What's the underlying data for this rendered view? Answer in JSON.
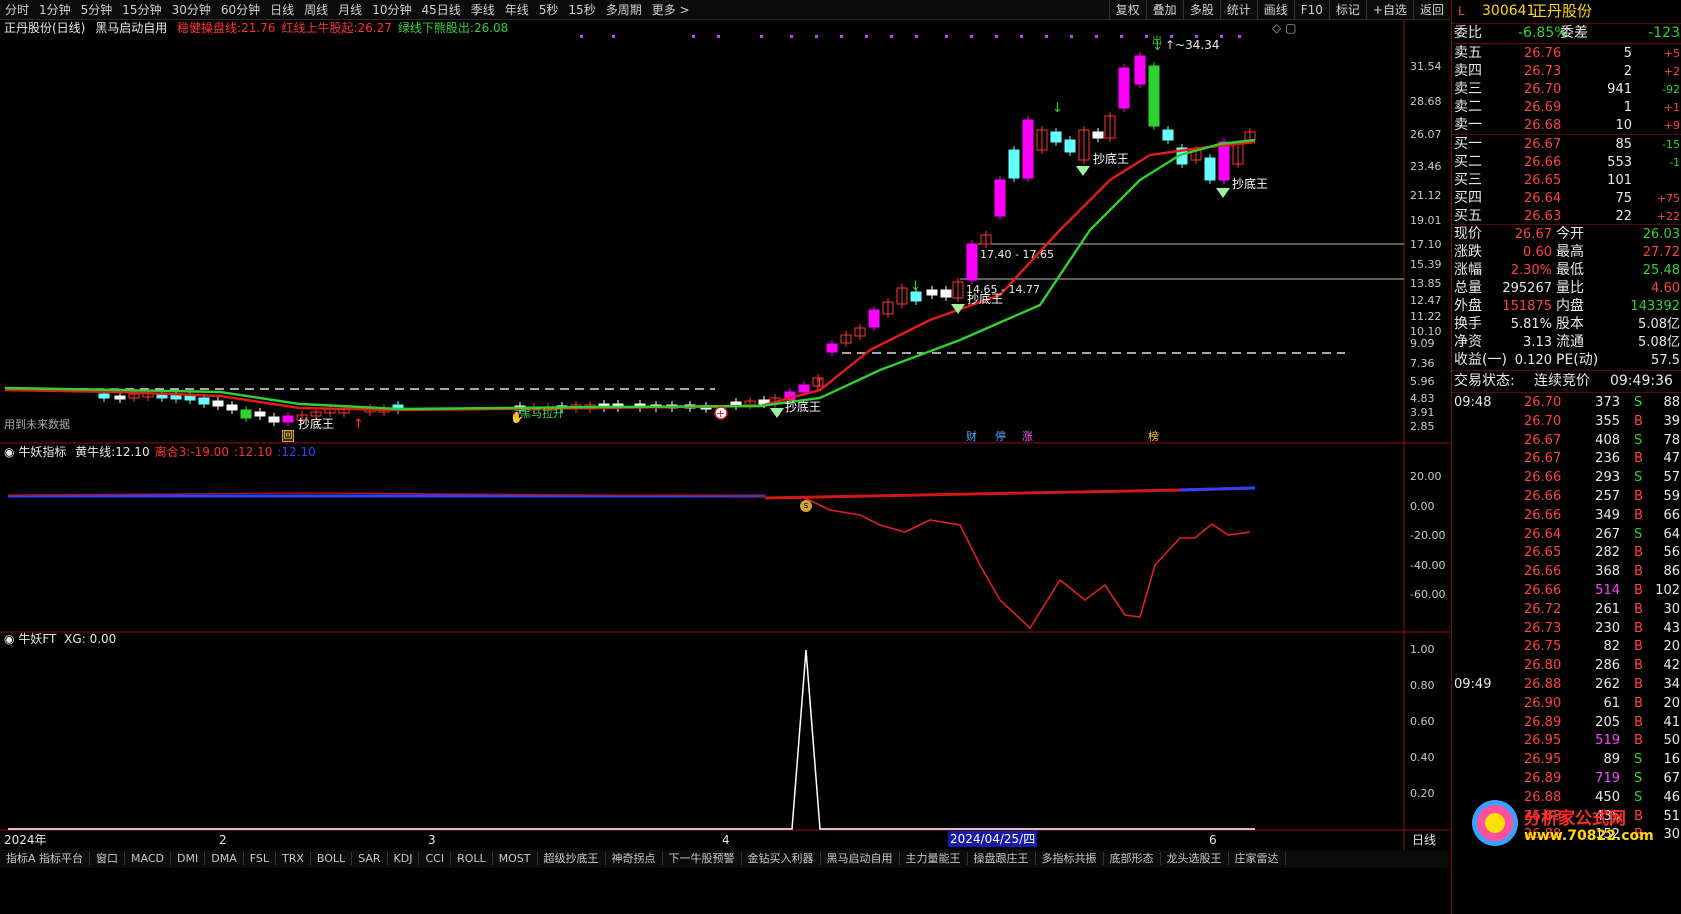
{
  "toolbar": {
    "tabs": [
      "分时",
      "1分钟",
      "5分钟",
      "15分钟",
      "30分钟",
      "60分钟",
      "日线",
      "周线",
      "月线",
      "10分钟",
      "45日线",
      "季线",
      "年线",
      "5秒",
      "15秒",
      "多周期",
      "更多 >"
    ],
    "tools": [
      "复权",
      "叠加",
      "多股",
      "统计",
      "画线",
      "F10",
      "标记",
      "+自选",
      "返回"
    ]
  },
  "main_chart": {
    "title": "正丹股份(日线)",
    "strategy": "黑马启动自用",
    "items": [
      {
        "label": "稳健操盘线",
        "value": "21.76",
        "color": "#ff3030"
      },
      {
        "label": "红线上牛股起",
        "value": "26.27",
        "color": "#ff3030"
      },
      {
        "label": "绿线下熊股出",
        "value": "26.08",
        "color": "#2fd12f"
      }
    ],
    "y_ticks": [
      "31.54",
      "28.68",
      "26.07",
      "23.46",
      "21.12",
      "19.01",
      "17.10",
      "15.39",
      "13.85",
      "12.47",
      "11.22",
      "10.10",
      "9.09",
      "7.36",
      "5.96",
      "4.83",
      "3.91",
      "2.85"
    ],
    "peak_label": "34.34",
    "range_labels": [
      "17.40 - 17.65",
      "14.65 - 14.77"
    ],
    "notes": [
      "用到未来数据"
    ],
    "signals": [
      "抄底王",
      "抄底王",
      "黑马拉升",
      "抄底王",
      "抄底王",
      "抄底王"
    ],
    "events": [
      "财",
      "停",
      "涨",
      "榜"
    ],
    "icon_labels": [
      "回",
      "s",
      "出"
    ]
  },
  "indicator1": {
    "title": "牛妖指标",
    "items": [
      {
        "label": "黄牛线",
        "value": "12.10",
        "color": "#e8e8e8"
      },
      {
        "label": "离合3",
        "value": "-19.00",
        "color": "#ff3030"
      },
      {
        "label": "",
        "value": "12.10",
        "color": "#ff3030"
      },
      {
        "label": "",
        "value": "12.10",
        "color": "#3040ff"
      }
    ],
    "y_ticks": [
      "20.00",
      "0.00",
      "-20.00",
      "-40.00",
      "-60.00"
    ]
  },
  "indicator2": {
    "title": "牛妖FT",
    "items": [
      {
        "label": "XG",
        "value": "0.00"
      }
    ],
    "y_ticks": [
      "1.00",
      "0.80",
      "0.60",
      "0.40",
      "0.20"
    ]
  },
  "x_axis": {
    "labels": [
      "2024年",
      "2",
      "3",
      "4",
      "2024/04/25/四",
      "6"
    ],
    "period": "日线"
  },
  "bottom_tabs": [
    "指标A 指标平台",
    "窗口",
    "MACD",
    "DMI",
    "DMA",
    "FSL",
    "TRX",
    "BOLL",
    "SAR",
    "KDJ",
    "CCI",
    "ROLL",
    "MOST",
    "超级抄底王",
    "神奇拐点",
    "下一牛股预警",
    "金钻买入利器",
    "黑马启动自用",
    "主力量能王",
    "操盘跟庄王",
    "多指标共振",
    "底部形态",
    "龙头选股王",
    "庄家雷达"
  ],
  "quote": {
    "code": "300641",
    "name": "正丹股份",
    "market": "L",
    "webi_label": "委比",
    "webi": "-6.85%",
    "weicha_label": "委差",
    "weicha": "-123",
    "asks": [
      {
        "label": "卖五",
        "price": "26.76",
        "vol": "5",
        "chg": "+5"
      },
      {
        "label": "卖四",
        "price": "26.73",
        "vol": "2",
        "chg": "+2"
      },
      {
        "label": "卖三",
        "price": "26.70",
        "vol": "941",
        "chg": "-92"
      },
      {
        "label": "卖二",
        "price": "26.69",
        "vol": "1",
        "chg": "+1"
      },
      {
        "label": "卖一",
        "price": "26.68",
        "vol": "10",
        "chg": "+9"
      }
    ],
    "bids": [
      {
        "label": "买一",
        "price": "26.67",
        "vol": "85",
        "chg": "-15"
      },
      {
        "label": "买二",
        "price": "26.66",
        "vol": "553",
        "chg": "-1"
      },
      {
        "label": "买三",
        "price": "26.65",
        "vol": "101",
        "chg": ""
      },
      {
        "label": "买四",
        "price": "26.64",
        "vol": "75",
        "chg": "+75"
      },
      {
        "label": "买五",
        "price": "26.63",
        "vol": "22",
        "chg": "+22"
      }
    ],
    "stats": [
      {
        "l1": "现价",
        "v1": "26.67",
        "c1": "up",
        "l2": "今开",
        "v2": "26.03",
        "c2": "dn"
      },
      {
        "l1": "涨跌",
        "v1": "0.60",
        "c1": "up",
        "l2": "最高",
        "v2": "27.72",
        "c2": "up"
      },
      {
        "l1": "涨幅",
        "v1": "2.30%",
        "c1": "up",
        "l2": "最低",
        "v2": "25.48",
        "c2": "dn"
      },
      {
        "l1": "总量",
        "v1": "295267",
        "c1": "wh",
        "l2": "量比",
        "v2": "4.60",
        "c2": "up"
      },
      {
        "l1": "外盘",
        "v1": "151875",
        "c1": "up",
        "l2": "内盘",
        "v2": "143392",
        "c2": "dn"
      },
      {
        "l1": "换手",
        "v1": "5.81%",
        "c1": "wh",
        "l2": "股本",
        "v2": "5.08亿",
        "c2": "wh"
      },
      {
        "l1": "净资",
        "v1": "3.13",
        "c1": "wh",
        "l2": "流通",
        "v2": "5.08亿",
        "c2": "wh"
      },
      {
        "l1": "收益(一)",
        "v1": "0.120",
        "c1": "wh",
        "l2": "PE(动)",
        "v2": "57.5",
        "c2": "wh"
      }
    ],
    "status_label": "交易状态:",
    "status": "连续竞价",
    "status_time": "09:49:36",
    "ticks": [
      {
        "time": "09:48",
        "price": "26.70",
        "vol": "373",
        "side": "S",
        "n": "88"
      },
      {
        "time": "",
        "price": "26.70",
        "vol": "355",
        "side": "B",
        "n": "39"
      },
      {
        "time": "",
        "price": "26.67",
        "vol": "408",
        "side": "S",
        "n": "78"
      },
      {
        "time": "",
        "price": "26.67",
        "vol": "236",
        "side": "B",
        "n": "47"
      },
      {
        "time": "",
        "price": "26.66",
        "vol": "293",
        "side": "S",
        "n": "57"
      },
      {
        "time": "",
        "price": "26.66",
        "vol": "257",
        "side": "B",
        "n": "59"
      },
      {
        "time": "",
        "price": "26.66",
        "vol": "349",
        "side": "B",
        "n": "66"
      },
      {
        "time": "",
        "price": "26.64",
        "vol": "267",
        "side": "S",
        "n": "64"
      },
      {
        "time": "",
        "price": "26.65",
        "vol": "282",
        "side": "B",
        "n": "56"
      },
      {
        "time": "",
        "price": "26.66",
        "vol": "368",
        "side": "B",
        "n": "86"
      },
      {
        "time": "",
        "price": "26.66",
        "vol": "514",
        "side": "B",
        "n": "102"
      },
      {
        "time": "",
        "price": "26.72",
        "vol": "261",
        "side": "B",
        "n": "30"
      },
      {
        "time": "",
        "price": "26.73",
        "vol": "230",
        "side": "B",
        "n": "43"
      },
      {
        "time": "",
        "price": "26.75",
        "vol": "82",
        "side": "B",
        "n": "20"
      },
      {
        "time": "",
        "price": "26.80",
        "vol": "286",
        "side": "B",
        "n": "42"
      },
      {
        "time": "09:49",
        "price": "26.88",
        "vol": "262",
        "side": "B",
        "n": "34"
      },
      {
        "time": "",
        "price": "26.90",
        "vol": "61",
        "side": "B",
        "n": "20"
      },
      {
        "time": "",
        "price": "26.89",
        "vol": "205",
        "side": "B",
        "n": "41"
      },
      {
        "time": "",
        "price": "26.95",
        "vol": "519",
        "side": "B",
        "n": "50"
      },
      {
        "time": "",
        "price": "26.95",
        "vol": "89",
        "side": "S",
        "n": "16"
      },
      {
        "time": "",
        "price": "26.89",
        "vol": "719",
        "side": "S",
        "n": "67"
      },
      {
        "time": "",
        "price": "26.88",
        "vol": "450",
        "side": "S",
        "n": "46"
      },
      {
        "time": "",
        "price": "26.88",
        "vol": "435",
        "side": "B",
        "n": "51"
      },
      {
        "time": "",
        "price": "26.88",
        "vol": "152",
        "side": "B",
        "n": "30"
      }
    ],
    "watermark": "分析家公式网",
    "watermark_url": "www.70822.com"
  }
}
